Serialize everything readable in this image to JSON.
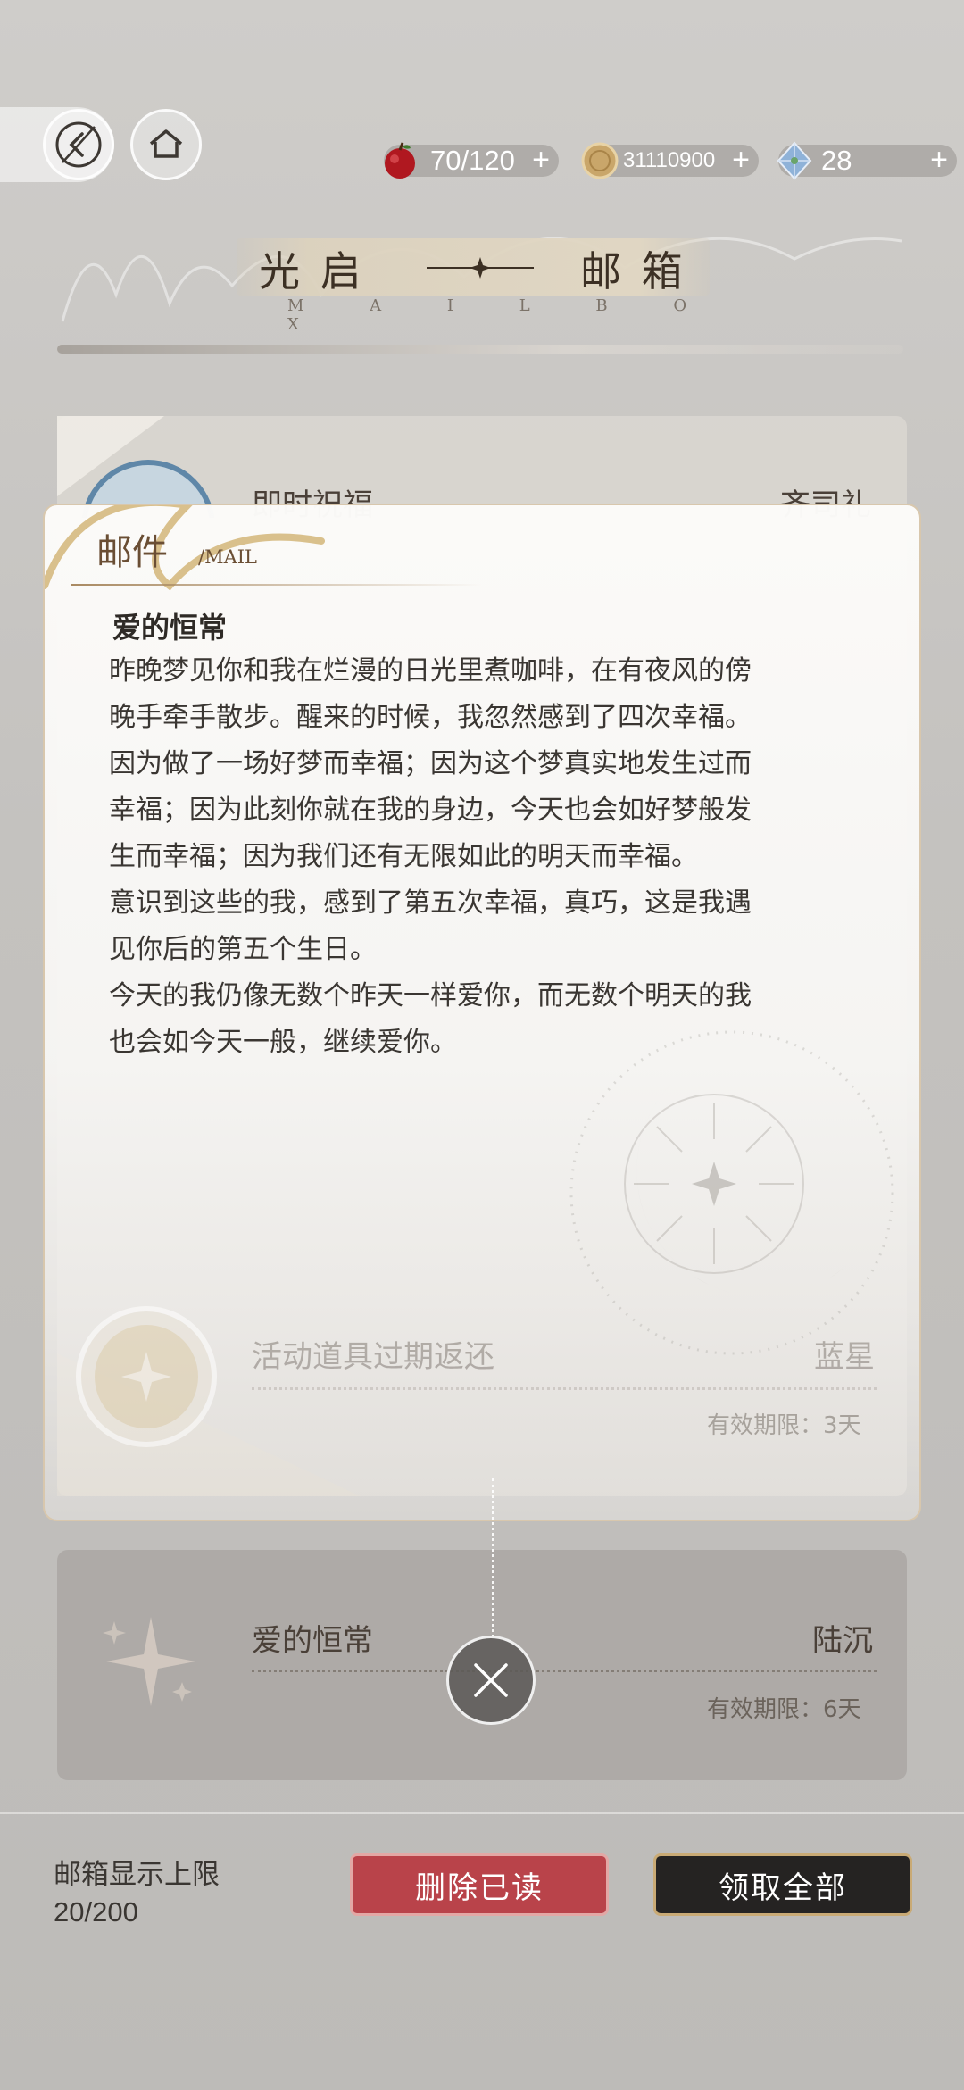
{
  "topbar": {
    "apple": {
      "value": "70/120",
      "plus": "+"
    },
    "coins": {
      "value": "31110900",
      "plus": "+"
    },
    "crystals": {
      "value": "28",
      "plus": "+"
    }
  },
  "header": {
    "title_left": "光 启",
    "title_right": "邮 箱",
    "subtitle": "M A I L B O X"
  },
  "mail_list": [
    {
      "title": "即时祝福",
      "sender": "齐司礼",
      "expiry": ""
    },
    {
      "title": "活动道具过期返还",
      "sender": "蓝星",
      "expiry": "有效期限：3天"
    },
    {
      "title": "爱的恒常",
      "sender": "陆沉",
      "expiry": "有效期限：6天"
    }
  ],
  "modal": {
    "label": "邮件",
    "label_en": "/MAIL",
    "letter_title": "爱的恒常",
    "letter_lines": [
      "昨晚梦见你和我在烂漫的日光里煮咖啡，在有夜风的傍",
      "晚手牵手散步。醒来的时候，我忽然感到了四次幸福。",
      "因为做了一场好梦而幸福；因为这个梦真实地发生过而",
      "幸福；因为此刻你就在我的身边，今天也会如好梦般发",
      "生而幸福；因为我们还有无限如此的明天而幸福。",
      "意识到这些的我，感到了第五次幸福，真巧，这是我遇",
      "见你后的第五个生日。",
      "今天的我仍像无数个昨天一样爱你，而无数个明天的我",
      "也会如今天一般，继续爱你。"
    ]
  },
  "footer": {
    "capacity_label": "邮箱显示上限",
    "capacity_value": "20/200",
    "delete_read": "删除已读",
    "claim_all": "领取全部"
  },
  "colors": {
    "delete_button": "#b9434a",
    "claim_button": "#252322",
    "accent_gold": "#c9aa75"
  }
}
